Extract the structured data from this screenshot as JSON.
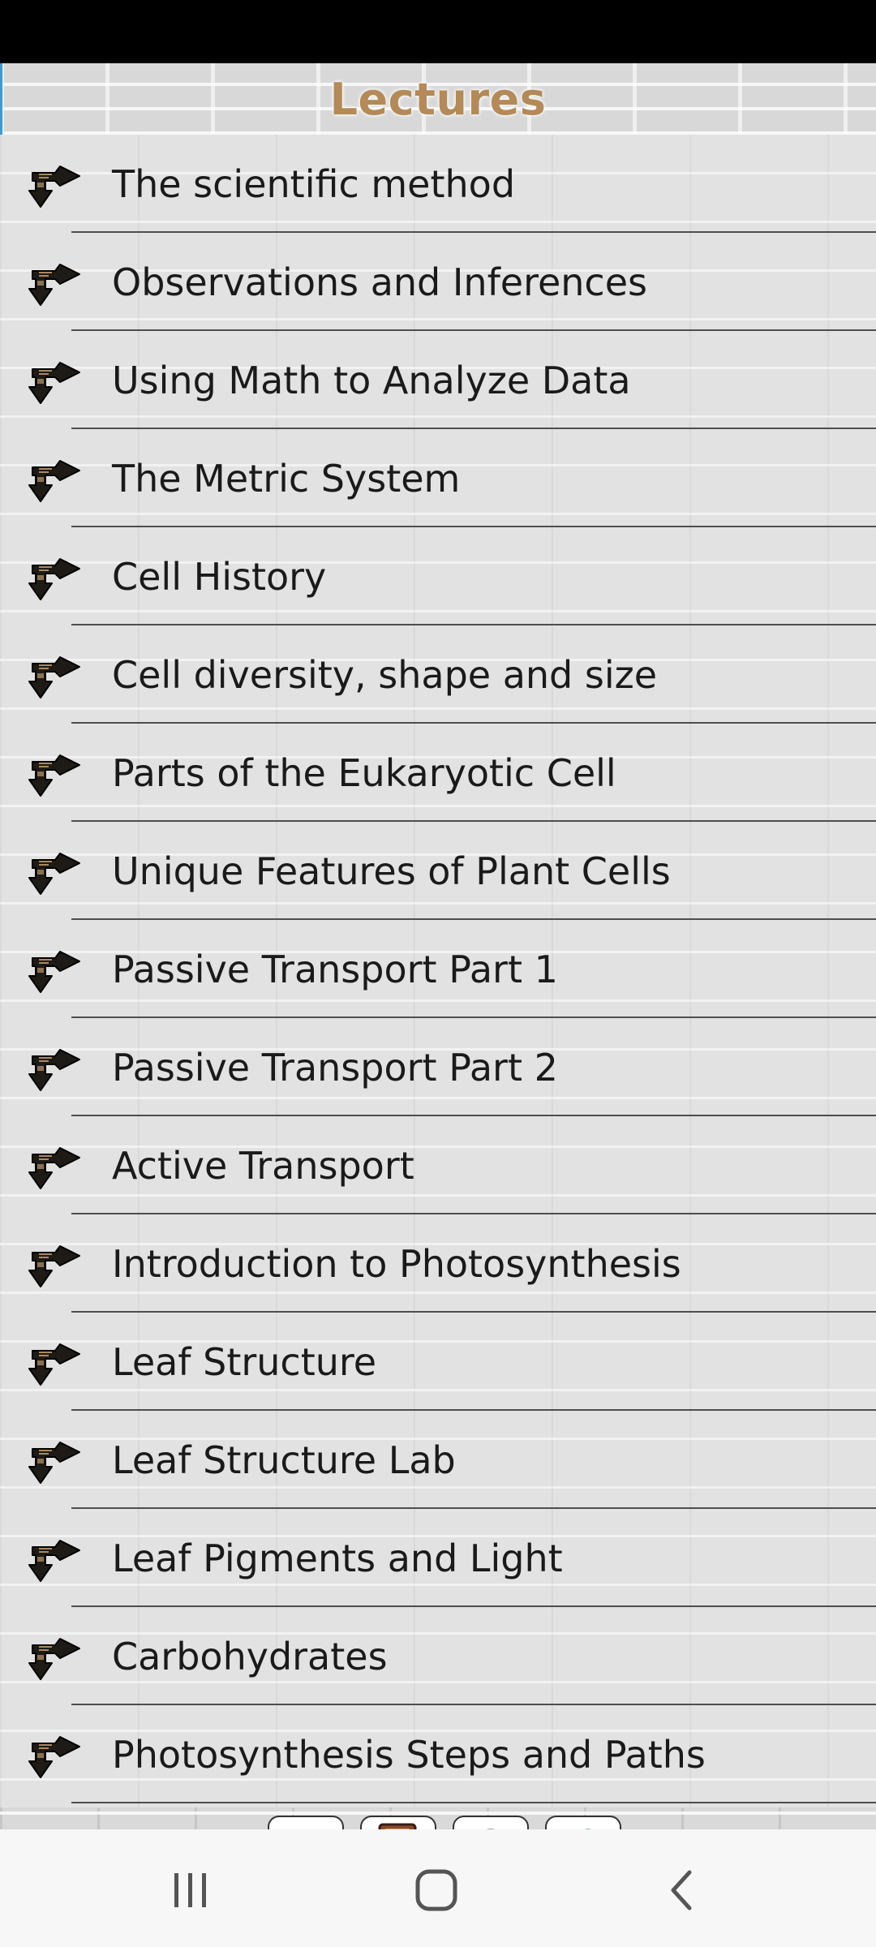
{
  "header": {
    "title": "Lectures"
  },
  "lectures": [
    {
      "label": "The scientific method"
    },
    {
      "label": "Observations and Inferences"
    },
    {
      "label": "Using Math to Analyze Data"
    },
    {
      "label": "The Metric System"
    },
    {
      "label": "Cell History"
    },
    {
      "label": "Cell diversity, shape and size"
    },
    {
      "label": "Parts of the Eukaryotic Cell"
    },
    {
      "label": "Unique Features of Plant Cells"
    },
    {
      "label": "Passive Transport Part 1"
    },
    {
      "label": "Passive Transport Part 2"
    },
    {
      "label": "Active Transport"
    },
    {
      "label": "Introduction to Photosynthesis"
    },
    {
      "label": "Leaf Structure"
    },
    {
      "label": "Leaf Structure Lab"
    },
    {
      "label": "Leaf Pigments and Light"
    },
    {
      "label": "Carbohydrates"
    },
    {
      "label": "Photosynthesis Steps and Paths"
    }
  ],
  "toolbar": {
    "buttons": [
      {
        "icon": "back-arrow-icon"
      },
      {
        "icon": "book-icon"
      },
      {
        "icon": "settings-dial-icon"
      },
      {
        "icon": "magnifier-search-icon"
      }
    ]
  },
  "system_nav": {
    "icons": [
      "recent-apps-icon",
      "home-icon",
      "back-icon"
    ]
  },
  "colors": {
    "title": "#b38a58",
    "status_bar": "#000000",
    "divider": "#4e4e4e"
  }
}
